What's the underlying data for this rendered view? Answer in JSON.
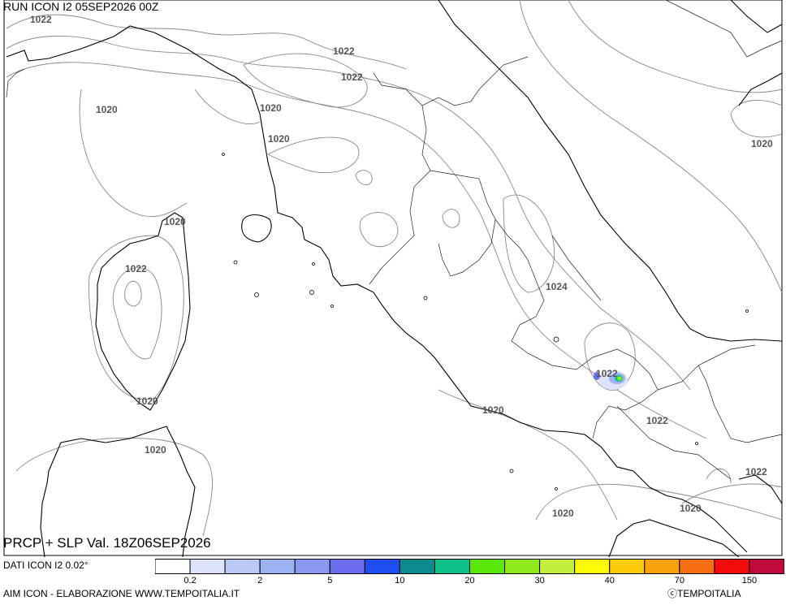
{
  "header": {
    "run_title": "RUN ICON I2 05SEP2026 00Z"
  },
  "footer": {
    "product_title": "PRCP + SLP Val. 18Z06SEP2026",
    "dati": "DATI ICON I2 0.02°",
    "elaborazione": "AIM ICON - ELABORAZIONE WWW.TEMPOITALIA.IT",
    "brand": "TEMPOITALIA",
    "brand_symbol": "ⓒ"
  },
  "isobar_labels": [
    "1022",
    "1022",
    "1022",
    "1020",
    "1020",
    "1020",
    "1020",
    "1022",
    "1020",
    "1020",
    "1020",
    "1024",
    "1022",
    "1020",
    "1022",
    "1022",
    "1020",
    "1020"
  ],
  "legend": {
    "colors": [
      "#ffffff",
      "#dce3fa",
      "#bcc9f5",
      "#9db2f2",
      "#8a99ef",
      "#6b6ded",
      "#1e4ef0",
      "#0a8c8c",
      "#0fbf8a",
      "#5ae80a",
      "#8ee81c",
      "#c4ee3c",
      "#fcfc06",
      "#fccc0a",
      "#f8a20e",
      "#f66e12",
      "#f20c0c",
      "#c00a3e"
    ],
    "tick_labels": [
      "0.2",
      "2",
      "5",
      "10",
      "20",
      "30",
      "40",
      "70",
      "150"
    ]
  },
  "map_style": {
    "coast_color": "#000000",
    "isobar_color": "#888888",
    "border_color": "#222222"
  }
}
